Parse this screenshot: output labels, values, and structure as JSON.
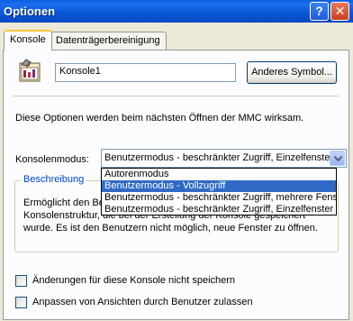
{
  "window": {
    "title": "Optionen"
  },
  "titlebar": {
    "help_glyph": "?",
    "close_glyph": "✕"
  },
  "tabs": [
    {
      "label": "Konsole",
      "active": true
    },
    {
      "label": "Datenträgerbereinigung",
      "active": false
    }
  ],
  "console": {
    "name_value": "Konsole1",
    "change_icon_button": "Anderes Symbol...",
    "info_text": "Diese Optionen werden beim nächsten Öffnen der MMC wirksam.",
    "mode_label": "Konsolenmodus:",
    "mode_selected": "Benutzermodus - beschränkter Zugriff, Einzelfenster",
    "mode_options": [
      "Autorenmodus",
      "Benutzermodus - Vollzugriff",
      "Benutzermodus - beschränkter Zugriff, mehrere Fenster",
      "Benutzermodus - beschränkter Zugriff, Einzelfenster"
    ],
    "highlighted_option_index": 1
  },
  "description": {
    "title": "Beschreibung",
    "lines": [
      "Ermöglicht den Benutzern",
      "Konsolenstruktur, die bei der Erstellung der Konsole gespeichert",
      "wurde. Es ist den Benutzern nicht möglich, neue Fenster zu öffnen."
    ]
  },
  "checkboxes": [
    {
      "label": "Änderungen für diese Konsole nicht speichern",
      "checked": false
    },
    {
      "label": "Anpassen von Ansichten durch Benutzer zulassen",
      "checked": false
    }
  ],
  "colors": {
    "titlebar": "#0A58D8",
    "selection": "#316AC5",
    "tab_highlight": "#FFC83C",
    "group_title": "#0046D5"
  },
  "icons": [
    "help-icon",
    "close-icon",
    "mmc-console-icon",
    "dropdown-arrow-icon"
  ]
}
